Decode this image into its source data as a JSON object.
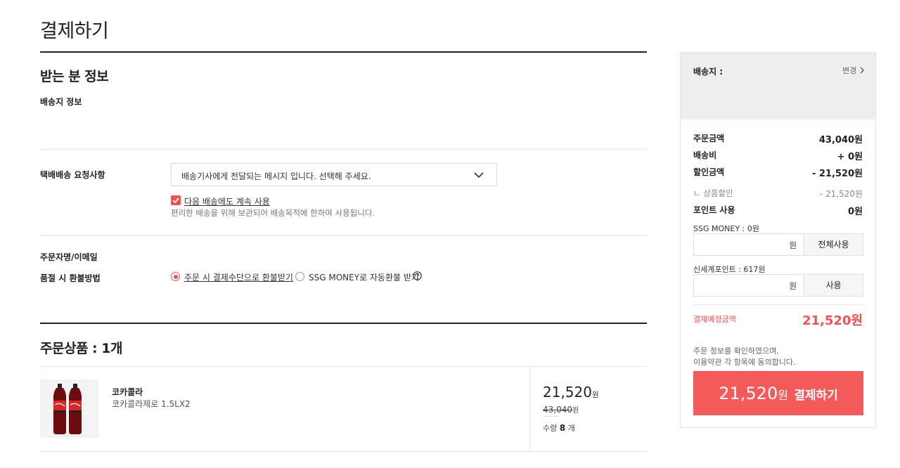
{
  "page": {
    "title": "결제하기"
  },
  "recipient": {
    "section_title": "받는 분 정보",
    "address_label": "배송지 정보",
    "request_label": "택배배송 요청사항",
    "request_select_value": "배송기사에게 전달되는 메시지 입니다. 선택해 주세요.",
    "keep_checkbox_label": "다음 배송에도 계속 사용",
    "keep_checkbox_help": "편리한 배송을 위해 보관되어 배송목적에 한하여 사용됩니다.",
    "orderer_label": "주문자명/이메일",
    "refund_label": "품절 시 환불방법",
    "refund_options": [
      "주문 시 결제수단으로 환불받기",
      "SSG MONEY로 자동환불 받기"
    ],
    "refund_selected_index": 0
  },
  "products": {
    "section_title": "주문상품 : 1개",
    "items": [
      {
        "brand": "코카콜라",
        "name": "코카콜라제로 1.5LX2",
        "price": "21,520",
        "price_unit": "원",
        "original_price": "43,040",
        "original_unit": "원",
        "qty_label": "수량",
        "qty": "8",
        "qty_unit": "개"
      }
    ]
  },
  "sidebar": {
    "ship_label": "배송지 :",
    "change_label": "변경",
    "order_amount_label": "주문금액",
    "order_amount": "43,040원",
    "shipping_label": "배송비",
    "shipping": "+ 0원",
    "discount_label": "할인금액",
    "discount": "- 21,520원",
    "product_discount_label": "ㄴ 상품할인",
    "product_discount": "- 21,520원",
    "points_label": "포인트 사용",
    "points": "0원",
    "ssg_money_label": "SSG MONEY : 0원",
    "won_unit": "원",
    "use_all_button": "전체사용",
    "shinsegae_label": "신세계포인트 : 617원",
    "use_button": "사용",
    "expected_label": "결제예정금액",
    "expected_amount": "21,520원",
    "agree_line1": "주문 정보를 확인하였으며,",
    "agree_line2": "이용약관 각 항목에 동의합니다.",
    "pay_amount": "21,520",
    "pay_unit": "원",
    "pay_label": "결제하기",
    "accent_color": "#f55a5a"
  }
}
